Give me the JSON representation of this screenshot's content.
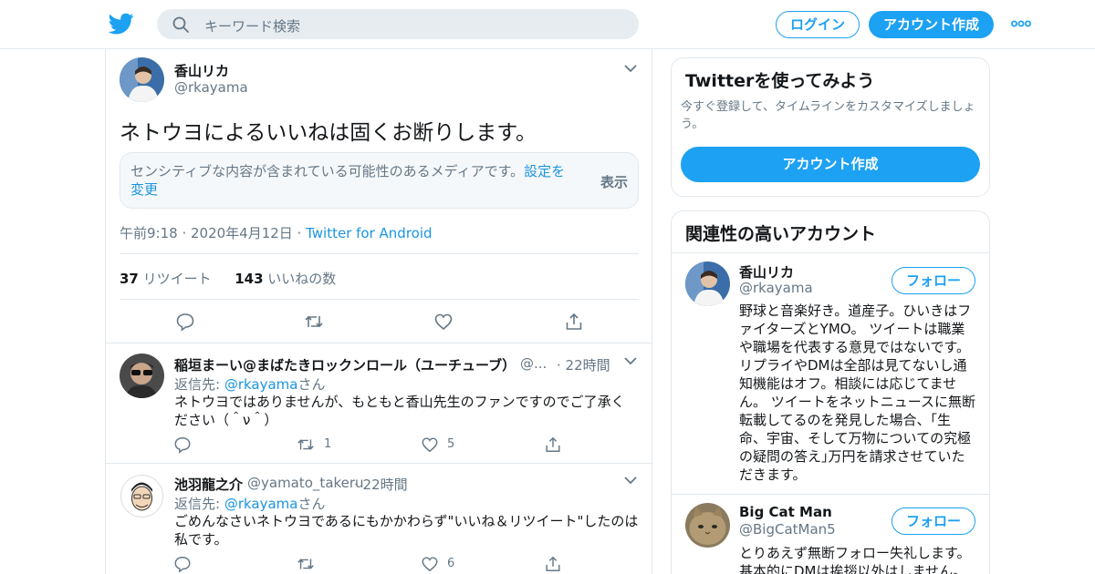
{
  "colors": {
    "accent": "#1da1f2",
    "link": "#1b95e0",
    "muted": "#657786",
    "border": "#e1e8ed"
  },
  "header": {
    "logo": "twitter-bird-icon",
    "search_placeholder": "キーワード検索",
    "login_label": "ログイン",
    "signup_label": "アカウント作成"
  },
  "tweet": {
    "name": "香山リカ",
    "handle": "@rkayama",
    "text": "ネトウヨによるいいねは固くお断りします。",
    "sensitive_text": "センシティブな内容が含まれている可能性のあるメディアです。",
    "sensitive_link": "設定を変更",
    "show_label": "表示",
    "time": "午前9:18 · 2020年4月12日 · ",
    "source": "Twitter for Android",
    "retweets": "37",
    "retweets_label": " リツイート",
    "likes": "143",
    "likes_label": " いいねの数"
  },
  "replies": [
    {
      "name": "稲垣まーい@まばたきロックンロール（ユーチューブ）",
      "handle": "@...",
      "time": "· 22時間",
      "reply_prefix": "返信先: ",
      "reply_to": "@rkayama",
      "reply_suffix": "さん",
      "text": "ネトウヨではありませんが、もともと香山先生のファンですのでご了承ください（＾ν＾）",
      "retweets": "1",
      "likes": "5"
    },
    {
      "name": "池羽龍之介",
      "handle": "@yamato_takeru",
      "time": "· 22時間",
      "reply_prefix": "返信先: ",
      "reply_to": "@rkayama",
      "reply_suffix": "さん",
      "text": "ごめんなさいネトウヨであるにもかかわらず\"いいね＆リツイート\"したのは私です。",
      "retweets": "",
      "likes": "6"
    }
  ],
  "sidebar": {
    "try_title": "Twitterを使ってみよう",
    "try_sub": "今すぐ登録して、タイムラインをカスタマイズしましょう。",
    "try_cta": "アカウント作成",
    "related_title": "関連性の高いアカウント",
    "follow_label": "フォロー",
    "accounts": [
      {
        "name": "香山リカ",
        "handle": "@rkayama",
        "bio": "野球と音楽好き。道産子。ひいきはファイターズとYMO。 ツイートは職業や職場を代表する意見ではないです。リプライやDMは全部は見てないし通知機能はオフ。相談には応じてません。 ツイートをネットニュースに無断転載してるのを発見した場合、｢生命、宇宙、そして万物についての究極の疑問の答え｣万円を請求させていただきます。"
      },
      {
        "name": "Big Cat Man",
        "handle": "@BigCatMan5",
        "bio": "とりあえず無断フォロー失礼します。基本的にDMは挨拶以外はしません。"
      }
    ]
  }
}
